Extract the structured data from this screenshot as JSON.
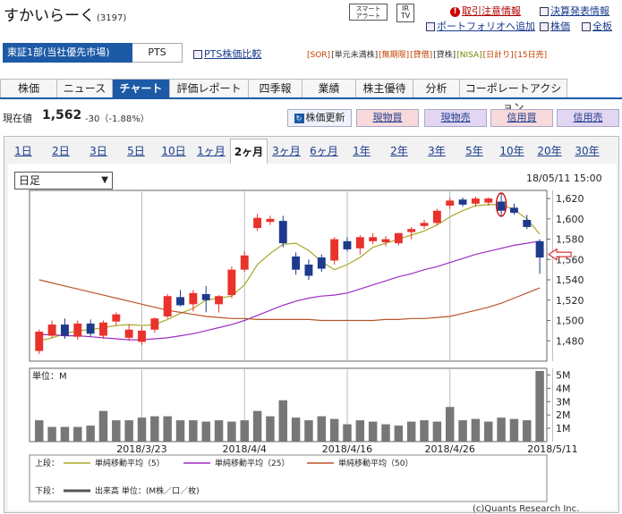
{
  "header": {
    "company_name": "すかいらーく",
    "code": "(3197)",
    "smart_alert": [
      "スマート",
      "アラート"
    ],
    "irtv": [
      "IR",
      "TV"
    ],
    "links": {
      "caution": "取引注意情報",
      "settlement": "決算発表情報",
      "portfolio": "ポートフォリオへ追加",
      "stock_price": "株価",
      "board": "全板"
    }
  },
  "market": {
    "selected": "東証1部(当社優先市場)",
    "pts": "PTS",
    "pts_compare": "PTS株価比較"
  },
  "tags": [
    "[SOR]",
    "[単元未満株]",
    "[無期限]",
    "[貸借]",
    "[貸株]",
    "[NISA]",
    "[日計り]",
    "[15日売]"
  ],
  "tag_colors": [
    "#c04000",
    "#333333",
    "#c04000",
    "#c04000",
    "#333333",
    "#6a8a00",
    "#c04000",
    "#c04000"
  ],
  "nav": {
    "tabs": [
      "株価",
      "ニュース",
      "チャート",
      "評価レポート",
      "四季報",
      "業績",
      "株主優待",
      "分析",
      "コーポレートアクション"
    ],
    "active": "チャート"
  },
  "price": {
    "label": "現在値",
    "value": "1,562",
    "change": "-30（-1.88%）"
  },
  "actions": {
    "refresh": "株価更新",
    "buy_spot": "現物買",
    "sell_spot": "現物売",
    "buy_margin": "信用買",
    "sell_margin": "信用売"
  },
  "periods": [
    "1日",
    "2日",
    "3日",
    "5日",
    "10日",
    "1ヶ月",
    "2ヶ月",
    "3ヶ月",
    "6ヶ月",
    "1年",
    "2年",
    "3年",
    "5年",
    "10年",
    "20年",
    "30年"
  ],
  "active_period": "2ヶ月",
  "chart_controls": {
    "interval": "日足",
    "timestamp": "18/05/11 15:00"
  },
  "colors": {
    "up": "#e8322b",
    "down": "#1e3a8c",
    "ma5": "#a8a82a",
    "ma25": "#9e2fc2",
    "ma50": "#b8552a",
    "volume": "#777777",
    "accent": "#1d5aa6"
  },
  "legend": {
    "upper_label": "上段：",
    "lower_label": "下段：",
    "ma5": "単純移動平均（5）",
    "ma25": "単純移動平均（25）",
    "ma50": "単純移動平均（50）",
    "volume": "出来高 単位：(M株／口／枚)"
  },
  "credit": "(c)Quants Research Inc.",
  "chart_data": {
    "type": "candlestick",
    "price_axis": {
      "ticks": [
        "1,480",
        "1,500",
        "1,520",
        "1,540",
        "1,560",
        "1,580",
        "1,600",
        "1,620"
      ],
      "ylim": [
        1460,
        1628
      ]
    },
    "volume_axis": {
      "unit_label": "単位：M",
      "ticks": [
        "1M",
        "2M",
        "3M",
        "4M",
        "5M"
      ],
      "ylim": [
        0,
        5.5
      ]
    },
    "x_tick_labels": [
      "2018/3/23",
      "2018/4/4",
      "2018/4/16",
      "2018/4/26",
      "2018/5/11"
    ],
    "x_tick_index": [
      8,
      16,
      24,
      32,
      40
    ],
    "candles": [
      {
        "o": 1470,
        "h": 1491,
        "l": 1467,
        "c": 1489
      },
      {
        "o": 1485,
        "h": 1500,
        "l": 1483,
        "c": 1496
      },
      {
        "o": 1496,
        "h": 1502,
        "l": 1482,
        "c": 1485
      },
      {
        "o": 1484,
        "h": 1500,
        "l": 1481,
        "c": 1497
      },
      {
        "o": 1497,
        "h": 1501,
        "l": 1484,
        "c": 1487
      },
      {
        "o": 1485,
        "h": 1500,
        "l": 1482,
        "c": 1498
      },
      {
        "o": 1499,
        "h": 1508,
        "l": 1495,
        "c": 1506
      },
      {
        "o": 1483,
        "h": 1496,
        "l": 1480,
        "c": 1491
      },
      {
        "o": 1479,
        "h": 1494,
        "l": 1476,
        "c": 1490
      },
      {
        "o": 1491,
        "h": 1503,
        "l": 1488,
        "c": 1502
      },
      {
        "o": 1504,
        "h": 1526,
        "l": 1502,
        "c": 1524
      },
      {
        "o": 1523,
        "h": 1530,
        "l": 1514,
        "c": 1515
      },
      {
        "o": 1516,
        "h": 1530,
        "l": 1509,
        "c": 1527
      },
      {
        "o": 1526,
        "h": 1534,
        "l": 1508,
        "c": 1520
      },
      {
        "o": 1516,
        "h": 1525,
        "l": 1508,
        "c": 1524
      },
      {
        "o": 1525,
        "h": 1553,
        "l": 1522,
        "c": 1550
      },
      {
        "o": 1550,
        "h": 1568,
        "l": 1548,
        "c": 1564
      },
      {
        "o": 1591,
        "h": 1605,
        "l": 1588,
        "c": 1601
      },
      {
        "o": 1597,
        "h": 1603,
        "l": 1594,
        "c": 1600
      },
      {
        "o": 1598,
        "h": 1603,
        "l": 1572,
        "c": 1576
      },
      {
        "o": 1563,
        "h": 1567,
        "l": 1545,
        "c": 1550
      },
      {
        "o": 1555,
        "h": 1560,
        "l": 1540,
        "c": 1544
      },
      {
        "o": 1562,
        "h": 1565,
        "l": 1548,
        "c": 1551
      },
      {
        "o": 1559,
        "h": 1582,
        "l": 1555,
        "c": 1580
      },
      {
        "o": 1578,
        "h": 1582,
        "l": 1568,
        "c": 1570
      },
      {
        "o": 1571,
        "h": 1584,
        "l": 1565,
        "c": 1582
      },
      {
        "o": 1578,
        "h": 1586,
        "l": 1575,
        "c": 1582
      },
      {
        "o": 1577,
        "h": 1583,
        "l": 1573,
        "c": 1580
      },
      {
        "o": 1576,
        "h": 1586,
        "l": 1574,
        "c": 1586
      },
      {
        "o": 1587,
        "h": 1592,
        "l": 1580,
        "c": 1590
      },
      {
        "o": 1593,
        "h": 1599,
        "l": 1590,
        "c": 1596
      },
      {
        "o": 1596,
        "h": 1610,
        "l": 1594,
        "c": 1608
      },
      {
        "o": 1613,
        "h": 1621,
        "l": 1610,
        "c": 1618
      },
      {
        "o": 1619,
        "h": 1621,
        "l": 1612,
        "c": 1614
      },
      {
        "o": 1615,
        "h": 1622,
        "l": 1612,
        "c": 1620
      },
      {
        "o": 1616,
        "h": 1621,
        "l": 1613,
        "c": 1620
      },
      {
        "o": 1617,
        "h": 1625,
        "l": 1603,
        "c": 1608
      },
      {
        "o": 1611,
        "h": 1615,
        "l": 1604,
        "c": 1606
      },
      {
        "o": 1599,
        "h": 1604,
        "l": 1590,
        "c": 1592
      },
      {
        "o": 1578,
        "h": 1580,
        "l": 1546,
        "c": 1562
      }
    ],
    "volume": [
      1.6,
      1.1,
      1.1,
      1.1,
      1.2,
      2.3,
      1.6,
      1.6,
      1.8,
      1.9,
      1.9,
      1.6,
      1.6,
      1.5,
      1.6,
      1.5,
      1.6,
      2.3,
      1.9,
      3.1,
      1.8,
      1.6,
      1.9,
      1.7,
      1.3,
      1.6,
      1.5,
      1.3,
      1.2,
      1.5,
      1.6,
      1.5,
      2.6,
      1.6,
      1.7,
      1.5,
      1.8,
      1.7,
      1.6,
      5.3
    ],
    "series": [
      {
        "name": "単純移動平均（5）",
        "values": [
          1480,
          1483,
          1487,
          1490,
          1491,
          1493,
          1495,
          1496,
          1495,
          1496,
          1501,
          1507,
          1512,
          1520,
          1522,
          1524,
          1535,
          1555,
          1566,
          1575,
          1576,
          1569,
          1558,
          1550,
          1555,
          1562,
          1572,
          1576,
          1580,
          1584,
          1588,
          1594,
          1602,
          1608,
          1613,
          1614,
          1614,
          1609,
          1600,
          1585
        ]
      },
      {
        "name": "単純移動平均（25）",
        "values": [
          1486,
          1486,
          1485,
          1485,
          1484,
          1483,
          1482,
          1481,
          1481,
          1482,
          1483,
          1485,
          1487,
          1490,
          1493,
          1496,
          1500,
          1505,
          1510,
          1515,
          1519,
          1522,
          1524,
          1525,
          1527,
          1531,
          1535,
          1539,
          1543,
          1546,
          1550,
          1553,
          1557,
          1561,
          1565,
          1568,
          1571,
          1574,
          1576,
          1578
        ]
      },
      {
        "name": "単純移動平均（50）",
        "values": [
          1540,
          1537,
          1534,
          1531,
          1528,
          1525,
          1522,
          1519,
          1516,
          1513,
          1510,
          1508,
          1506,
          1504,
          1503,
          1502,
          1502,
          1501,
          1501,
          1501,
          1501,
          1501,
          1500,
          1500,
          1500,
          1500,
          1500,
          1501,
          1501,
          1502,
          1502,
          1503,
          1504,
          1507,
          1510,
          1513,
          1517,
          1522,
          1527,
          1532
        ]
      }
    ]
  }
}
